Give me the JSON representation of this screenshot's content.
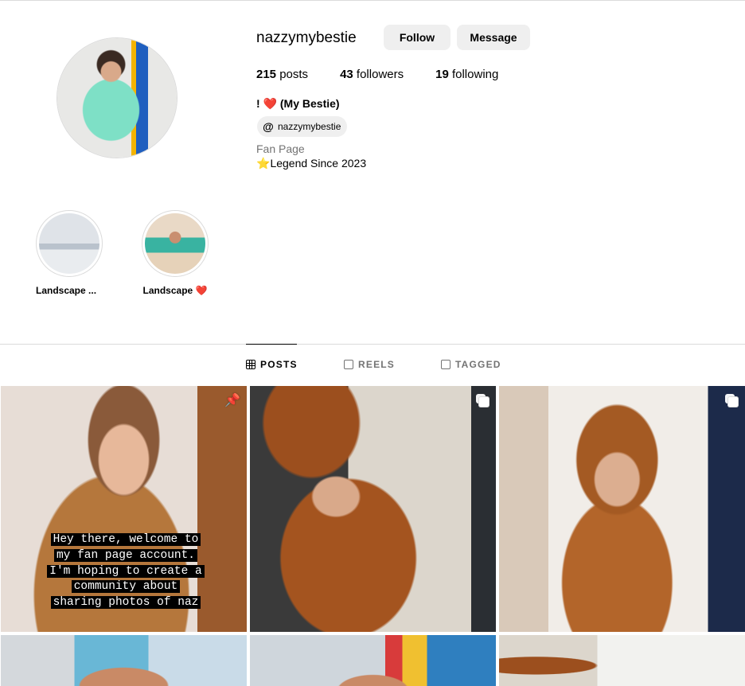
{
  "profile": {
    "username": "nazzymybestie",
    "follow_label": "Follow",
    "message_label": "Message",
    "stats": {
      "posts_count": "215",
      "posts_label": "posts",
      "followers_count": "43",
      "followers_label": "followers",
      "following_count": "19",
      "following_label": "following"
    },
    "full_name_prefix": "! ",
    "full_name_heart": "❤️",
    "full_name_suffix": " (My Bestie)",
    "threads_handle": "nazzymybestie",
    "category": "Fan Page",
    "bio_star": "⭐",
    "bio_text": "Legend Since 2023"
  },
  "highlights": [
    {
      "label": "Landscape ..."
    },
    {
      "label": "Landscape ❤️"
    }
  ],
  "tabs": {
    "posts": "POSTS",
    "reels": "REELS",
    "tagged": "TAGGED"
  },
  "posts": {
    "first_caption_lines": [
      "Hey there, welcome to",
      "my fan page account.",
      "I'm hoping to create a",
      "community about",
      "sharing photos of naz"
    ]
  },
  "colors": {
    "button_bg": "#efefef",
    "divider": "#dbdbdb",
    "secondary_text": "#737373"
  },
  "icons": [
    "pin-icon",
    "carousel-icon",
    "threads-icon",
    "grid-icon",
    "reels-icon",
    "tagged-icon"
  ]
}
